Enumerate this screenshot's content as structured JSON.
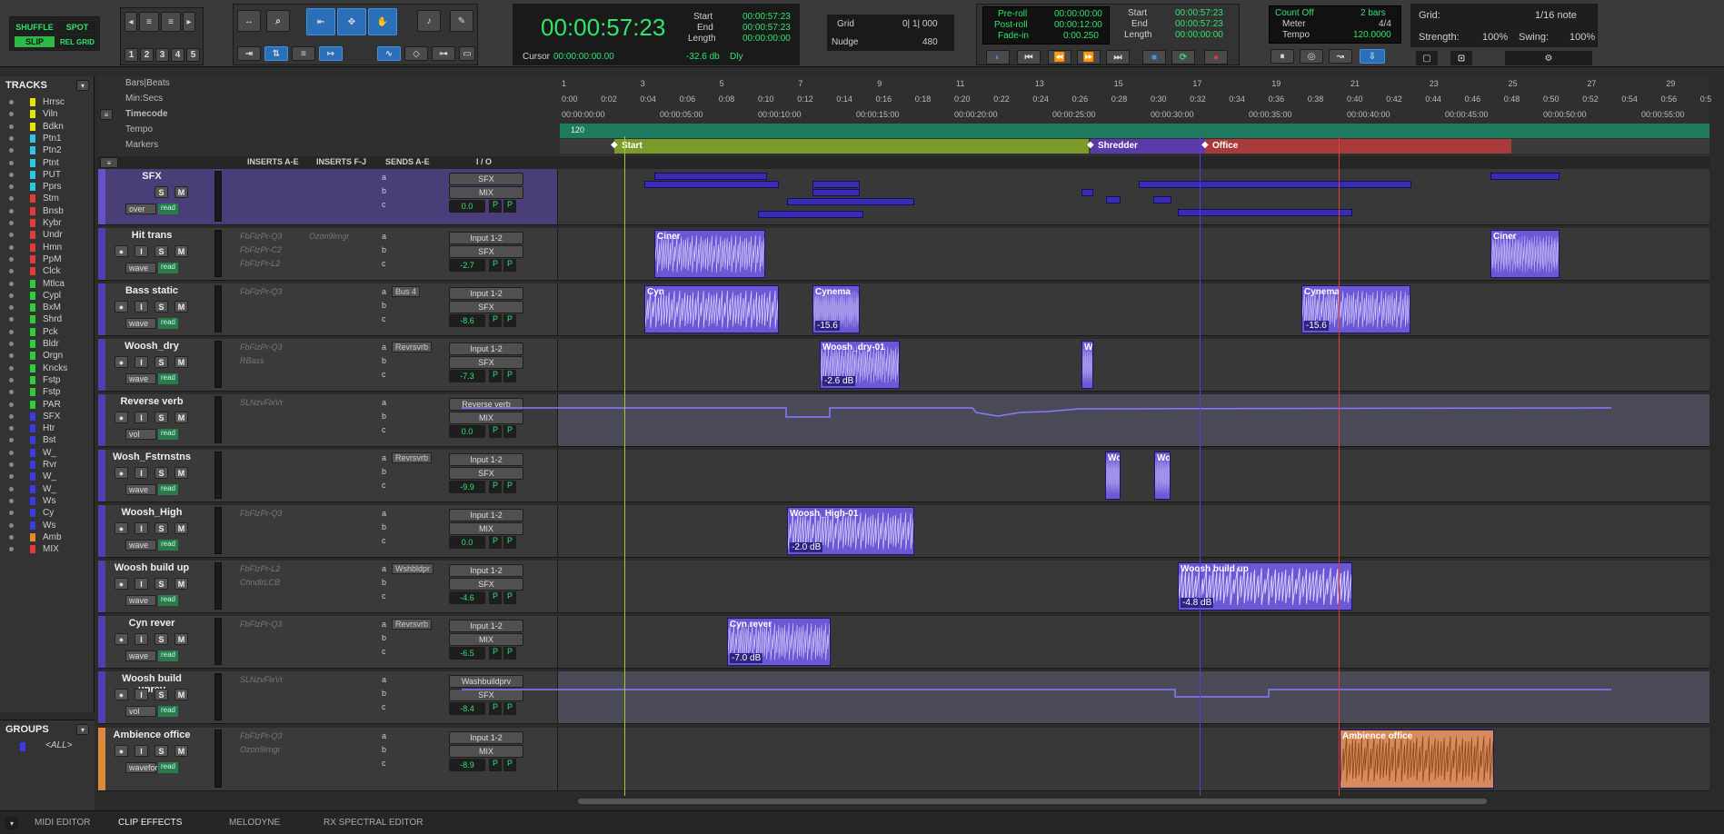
{
  "modes": {
    "shuffle": "SHUFFLE",
    "spot": "SPOT",
    "slip": "SLIP",
    "relgrid": "REL GRID"
  },
  "zoom_presets": [
    "1",
    "2",
    "3",
    "4",
    "5"
  ],
  "counter": {
    "main": "00:00:57:23",
    "start_label": "Start",
    "end_label": "End",
    "length_label": "Length",
    "start": "00:00:57:23",
    "end": "00:00:57:23",
    "length": "00:00:00:00",
    "cursor_label": "Cursor",
    "cursor": "00:00:00:00.00",
    "cursor_db": "-32.6 db",
    "dly": "Dly"
  },
  "grid": {
    "label": "Grid",
    "value": "0| 1| 000",
    "nudge_label": "Nudge",
    "nudge": "480"
  },
  "transport": {
    "preroll_label": "Pre-roll",
    "postroll_label": "Post-roll",
    "fadein_label": "Fade-in",
    "preroll": "00:00:00:00",
    "postroll": "00:00:12:00",
    "fadein": "0:00.250",
    "start_label": "Start",
    "end_label": "End",
    "length_label": "Length",
    "start": "00:00:57:23",
    "end": "00:00:57:23",
    "length": "00:00:00:00"
  },
  "count": {
    "count_label": "Count Off",
    "count_val": "2 bars",
    "meter_label": "Meter",
    "meter_val": "4/4",
    "tempo_label": "Tempo",
    "tempo_val": "120.0000"
  },
  "gridsettings": {
    "grid_label": "Grid:",
    "grid_val": "1/16 note",
    "strength_label": "Strength:",
    "strength_val": "100%",
    "swing_label": "Swing:",
    "swing_val": "100%"
  },
  "tracks_header": "TRACKS",
  "track_list": [
    {
      "name": "Hrrsc",
      "color": "#e6e600"
    },
    {
      "name": "Viln",
      "color": "#e6e600"
    },
    {
      "name": "Bdkn",
      "color": "#e6e600"
    },
    {
      "name": "Ptn1",
      "color": "#2ac8e6"
    },
    {
      "name": "Ptn2",
      "color": "#2ac8e6"
    },
    {
      "name": "Ptnt",
      "color": "#2ac8e6"
    },
    {
      "name": "PUT",
      "color": "#2ac8e6"
    },
    {
      "name": "Pprs",
      "color": "#2ac8e6"
    },
    {
      "name": "Stm",
      "color": "#e63a3a"
    },
    {
      "name": "Bnsb",
      "color": "#e63a3a"
    },
    {
      "name": "Kybr",
      "color": "#e63a3a"
    },
    {
      "name": "Undr",
      "color": "#e63a3a"
    },
    {
      "name": "Hmn",
      "color": "#e63a3a"
    },
    {
      "name": "PpM",
      "color": "#e63a3a"
    },
    {
      "name": "Clck",
      "color": "#e63a3a"
    },
    {
      "name": "Mtlca",
      "color": "#2ad03a"
    },
    {
      "name": "Cypl",
      "color": "#2ad03a"
    },
    {
      "name": "BxM",
      "color": "#2ad03a"
    },
    {
      "name": "Shrd",
      "color": "#2ad03a"
    },
    {
      "name": "Pck",
      "color": "#2ad03a"
    },
    {
      "name": "Bldr",
      "color": "#2ad03a"
    },
    {
      "name": "Orgn",
      "color": "#2ad03a"
    },
    {
      "name": "Kncks",
      "color": "#2ad03a"
    },
    {
      "name": "Fstp",
      "color": "#2ad03a"
    },
    {
      "name": "Fstp",
      "color": "#2ad03a"
    },
    {
      "name": "PAR",
      "color": "#2ad03a"
    },
    {
      "name": "SFX",
      "color": "#3a3ae6"
    },
    {
      "name": "Htr",
      "color": "#3a3ae6"
    },
    {
      "name": "Bst",
      "color": "#3a3ae6"
    },
    {
      "name": "W_",
      "color": "#3a3ae6"
    },
    {
      "name": "Rvr",
      "color": "#3a3ae6"
    },
    {
      "name": "W_",
      "color": "#3a3ae6"
    },
    {
      "name": "W_",
      "color": "#3a3ae6"
    },
    {
      "name": "Ws",
      "color": "#3a3ae6"
    },
    {
      "name": "Cy",
      "color": "#3a3ae6"
    },
    {
      "name": "Ws",
      "color": "#3a3ae6"
    },
    {
      "name": "Amb",
      "color": "#e68a2a"
    },
    {
      "name": "MIX",
      "color": "#e63a3a"
    }
  ],
  "groups_header": "GROUPS",
  "groups_all": "<ALL>",
  "rulers": {
    "bars": "Bars|Beats",
    "minsec": "Min:Secs",
    "timecode": "Timecode",
    "tempo": "Tempo",
    "markers": "Markers",
    "tempo_val": "120"
  },
  "bar_numbers": [
    "1",
    "3",
    "5",
    "7",
    "9",
    "11",
    "13",
    "15",
    "17",
    "19",
    "21",
    "23",
    "25",
    "27",
    "29"
  ],
  "minsec_ticks": [
    "0:00",
    "0:02",
    "0:04",
    "0:06",
    "0:08",
    "0:10",
    "0:12",
    "0:14",
    "0:16",
    "0:18",
    "0:20",
    "0:22",
    "0:24",
    "0:26",
    "0:28",
    "0:30",
    "0:32",
    "0:34",
    "0:36",
    "0:38",
    "0:40",
    "0:42",
    "0:44",
    "0:46",
    "0:48",
    "0:50",
    "0:52",
    "0:54",
    "0:56",
    "0:5"
  ],
  "timecode_ticks": [
    "00:00:00:00",
    "00:00:05:00",
    "00:00:10:00",
    "00:00:15:00",
    "00:00:20:00",
    "00:00:25:00",
    "00:00:30:00",
    "00:00:35:00",
    "00:00:40:00",
    "00:00:45:00",
    "00:00:50:00",
    "00:00:55:00"
  ],
  "markers": [
    {
      "name": "Start",
      "color": "#7a9a2a"
    },
    {
      "name": "Shredder",
      "color": "#5a3aa8"
    },
    {
      "name": "Office",
      "color": "#a83a3a"
    }
  ],
  "col_headers": {
    "ins_ae": "INSERTS A-E",
    "ins_fj": "INSERTS F-J",
    "sends": "SENDS A-E",
    "io": "I / O"
  },
  "tracks": [
    {
      "name": "SFX",
      "ins1": "",
      "ins2": "",
      "send_a": "",
      "io_in": "SFX",
      "io_out": "MIX",
      "vol": "0.0",
      "mode": "over"
    },
    {
      "name": "Hit trans",
      "ins1": "FbFlzPr-Q3",
      "ins2": "FbFlzPr-C2",
      "ins3": "FbFlzPr-L2",
      "insfj": "Ozon9Imgr",
      "send_a": "",
      "io_in": "Input 1-2",
      "io_out": "SFX",
      "vol": "-2.7",
      "mode": "wave"
    },
    {
      "name": "Bass static",
      "ins1": "FbFlzPr-Q3",
      "ins2": "",
      "send_a": "Bus 4",
      "io_in": "Input 1-2",
      "io_out": "SFX",
      "vol": "-8.6",
      "mode": "wave"
    },
    {
      "name": "Woosh_dry",
      "ins1": "FbFlzPr-Q3",
      "ins2": "RBass",
      "send_a": "Revrsvrb",
      "io_in": "Input 1-2",
      "io_out": "SFX",
      "vol": "-7.3",
      "mode": "wave"
    },
    {
      "name": "Reverse verb",
      "ins1": "SLNzvFlxVr",
      "ins2": "",
      "send_a": "",
      "io_in": "Reverse verb",
      "io_out": "MIX",
      "vol": "0.0",
      "mode": "vol"
    },
    {
      "name": "Wosh_Fstrnstns",
      "ins1": "",
      "ins2": "",
      "send_a": "Revrsvrb",
      "io_in": "Input 1-2",
      "io_out": "SFX",
      "vol": "-9.9",
      "mode": "wave"
    },
    {
      "name": "Woosh_High",
      "ins1": "FbFlzPr-Q3",
      "ins2": "",
      "send_a": "",
      "io_in": "Input 1-2",
      "io_out": "MIX",
      "vol": "0.0",
      "mode": "wave"
    },
    {
      "name": "Woosh build up",
      "ins1": "FbFlzPr-L2",
      "ins2": "ChndlrLCB",
      "send_a": "Wshbldpr",
      "io_in": "Input 1-2",
      "io_out": "SFX",
      "vol": "-4.6",
      "mode": "wave"
    },
    {
      "name": "Cyn rever",
      "ins1": "FbFlzPr-Q3",
      "ins2": "",
      "send_a": "Revrsvrb",
      "io_in": "Input 1-2",
      "io_out": "MIX",
      "vol": "-6.5",
      "mode": "wave"
    },
    {
      "name": "Woosh build uprev",
      "ins1": "SLNzvFlxVr",
      "ins2": "",
      "send_a": "",
      "io_in": "Washbuildprv",
      "io_out": "SFX",
      "vol": "-8.4",
      "mode": "vol"
    },
    {
      "name": "Ambience office",
      "ins1": "FbFlzPr-Q3",
      "ins2": "Ozon9Imgr",
      "send_a": "",
      "io_in": "Input 1-2",
      "io_out": "MIX",
      "vol": "-8.9",
      "mode": "waveform"
    }
  ],
  "clips": [
    {
      "name": "Ciner",
      "gain": ""
    },
    {
      "name": "Ciner",
      "gain": ""
    },
    {
      "name": "Cyn",
      "gain": ""
    },
    {
      "name": "Cynema",
      "gain": "-15.6"
    },
    {
      "name": "Woosh_dry-01",
      "gain": "-2.6 dB"
    },
    {
      "name": "W",
      "gain": ""
    },
    {
      "name": "Wo",
      "gain": ""
    },
    {
      "name": "Wo",
      "gain": ""
    },
    {
      "name": "Woosh_High-01",
      "gain": "-2.0 dB"
    },
    {
      "name": "Woosh build up",
      "gain": "-4.8 dB"
    },
    {
      "name": "Cyn rever",
      "gain": "-7.0 dB"
    },
    {
      "name": "Ambience office",
      "gain": ""
    }
  ],
  "bottom_tabs": [
    "MIDI EDITOR",
    "CLIP EFFECTS",
    "MELODYNE",
    "RX SPECTRAL EDITOR"
  ],
  "vol_label": "vol",
  "send_letters": [
    "a",
    "b",
    "c"
  ],
  "pp": "P"
}
